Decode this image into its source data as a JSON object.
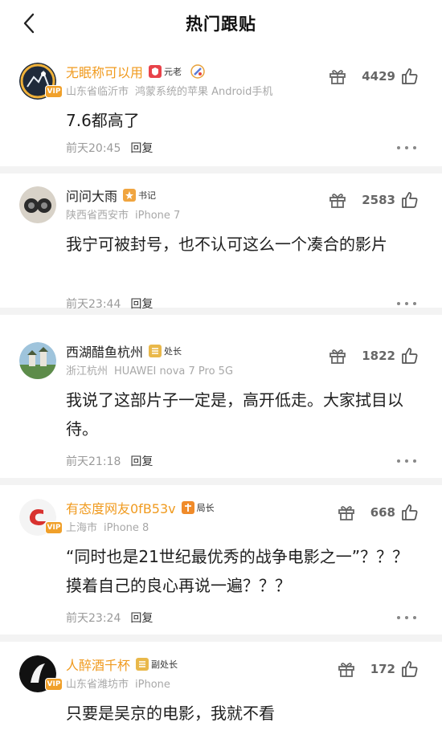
{
  "header": {
    "title": "热门跟贴"
  },
  "colors": {
    "vip_name": "#f09a1e",
    "meta": "#a8a8a8",
    "separator": "#f3f3f3"
  },
  "comments": [
    {
      "name": "无眠称可以用",
      "vip": true,
      "vip_label": "VIP",
      "badge": "元老",
      "badge_icon": "shield-badge-icon",
      "location": "山东省临沂市",
      "device": "鸿蒙系统的苹果 Android手机",
      "likes": "4429",
      "text": "7.6都高了",
      "time": "前天20:45",
      "reply": "回复"
    },
    {
      "name": "问问大雨",
      "vip": false,
      "badge": "书记",
      "badge_icon": "rank-badge-icon",
      "location": "陕西省西安市",
      "device": "iPhone 7",
      "likes": "2583",
      "text": "我宁可被封号，也不认可这么一个凑合的影片",
      "time": "前天23:44",
      "reply": "回复"
    },
    {
      "name": "西湖醋鱼杭州",
      "vip": false,
      "badge": "处长",
      "badge_icon": "rank-badge-icon",
      "location": "浙江杭州",
      "device": "HUAWEI nova 7 Pro 5G",
      "likes": "1822",
      "text": "我说了这部片子一定是，高开低走。大家拭目以待。",
      "time": "前天21:18",
      "reply": "回复"
    },
    {
      "name": "有态度网友0fB53v",
      "vip": true,
      "vip_label": "VIP",
      "badge": "局长",
      "badge_icon": "rank-badge-icon",
      "location": "上海市",
      "device": "iPhone 8",
      "likes": "668",
      "text": "“同时也是21世纪最优秀的战争电影之一”？？？摸着自己的良心再说一遍？？？",
      "time": "前天23:24",
      "reply": "回复"
    },
    {
      "name": "人醉酒千杯",
      "vip": true,
      "vip_label": "VIP",
      "badge": "副处长",
      "badge_icon": "rank-badge-icon",
      "location": "山东省潍坊市",
      "device": "iPhone",
      "likes": "172",
      "text": "只要是吴京的电影，我就不看",
      "time": "",
      "reply": ""
    }
  ]
}
